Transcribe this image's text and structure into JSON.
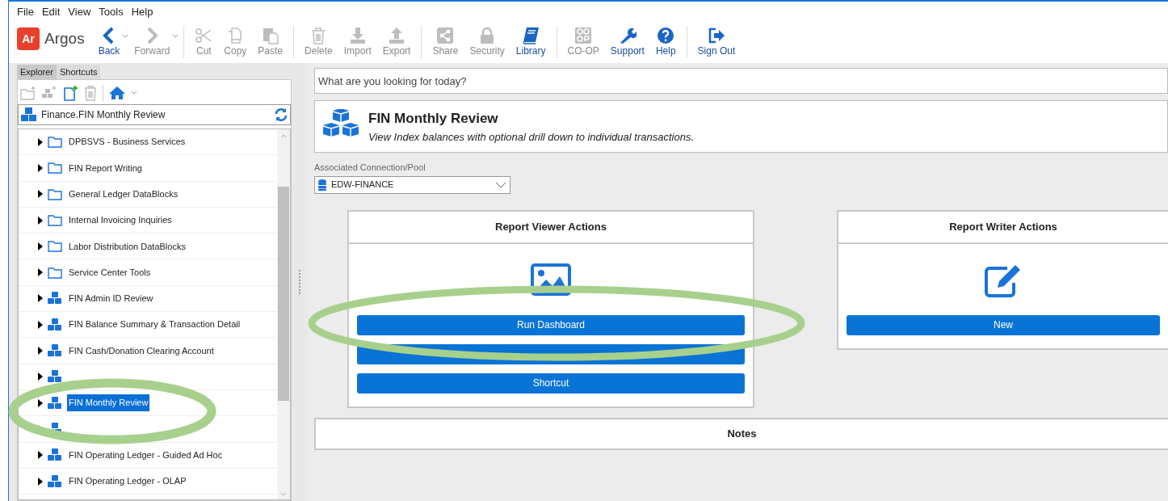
{
  "menu": [
    "File",
    "Edit",
    "View",
    "Tools",
    "Help"
  ],
  "logo": {
    "badge": "Ar",
    "name": "Argos"
  },
  "toolbar": [
    {
      "label": "Back",
      "enabled": true
    },
    {
      "label": "Forward",
      "enabled": false
    },
    {
      "label": "Cut",
      "enabled": false
    },
    {
      "label": "Copy",
      "enabled": false
    },
    {
      "label": "Paste",
      "enabled": false
    },
    {
      "label": "Delete",
      "enabled": false
    },
    {
      "label": "Import",
      "enabled": false
    },
    {
      "label": "Export",
      "enabled": false
    },
    {
      "label": "Share",
      "enabled": false
    },
    {
      "label": "Security",
      "enabled": false
    },
    {
      "label": "Library",
      "enabled": true
    },
    {
      "label": "CO-OP",
      "enabled": false
    },
    {
      "label": "Support",
      "enabled": true
    },
    {
      "label": "Help",
      "enabled": true
    },
    {
      "label": "Sign Out",
      "enabled": true
    }
  ],
  "panel_tabs": [
    {
      "label": "Explorer",
      "selected": true
    },
    {
      "label": "Shortcuts",
      "selected": false
    }
  ],
  "path": "Finance.FIN Monthly Review",
  "tree": [
    {
      "kind": "folder",
      "label": "DPBSVS - Business Services",
      "selected": false
    },
    {
      "kind": "folder",
      "label": "FIN Report Writing",
      "selected": false
    },
    {
      "kind": "folder",
      "label": "General Ledger DataBlocks",
      "selected": false
    },
    {
      "kind": "folder",
      "label": "Internal Invoicing Inquiries",
      "selected": false
    },
    {
      "kind": "folder",
      "label": "Labor Distribution DataBlocks",
      "selected": false
    },
    {
      "kind": "folder",
      "label": "Service Center Tools",
      "selected": false
    },
    {
      "kind": "report",
      "label": "FIN Admin ID Review",
      "selected": false
    },
    {
      "kind": "report",
      "label": "FIN Balance Summary & Transaction Detail",
      "selected": false
    },
    {
      "kind": "report",
      "label": "FIN Cash/Donation Clearing Account",
      "selected": false
    },
    {
      "kind": "report",
      "selected": false
    },
    {
      "kind": "report",
      "label": "FIN Monthly Review",
      "selected": true
    },
    {
      "kind": "report",
      "selected": false
    },
    {
      "kind": "report",
      "label": "FIN Operating Ledger - Guided Ad Hoc",
      "selected": false
    },
    {
      "kind": "report",
      "label": "FIN Operating Ledger - OLAP",
      "selected": false
    }
  ],
  "search": {
    "placeholder": "What are you looking for today?"
  },
  "header": {
    "title": "FIN Monthly Review",
    "description": "View Index balances with optional drill down to individual transactions."
  },
  "connection": {
    "label": "Associated Connection/Pool",
    "value": "EDW-FINANCE"
  },
  "viewer_actions": {
    "title": "Report Viewer Actions",
    "buttons": [
      {
        "kind": "labeled",
        "label": "Run Dashboard"
      },
      {
        "kind": "covered"
      },
      {
        "kind": "labeled",
        "label": "Shortcut"
      }
    ]
  },
  "writer_actions": {
    "title": "Report Writer Actions",
    "buttons": [
      {
        "kind": "labeled",
        "label": "New"
      }
    ]
  },
  "notes": {
    "title": "Notes"
  }
}
